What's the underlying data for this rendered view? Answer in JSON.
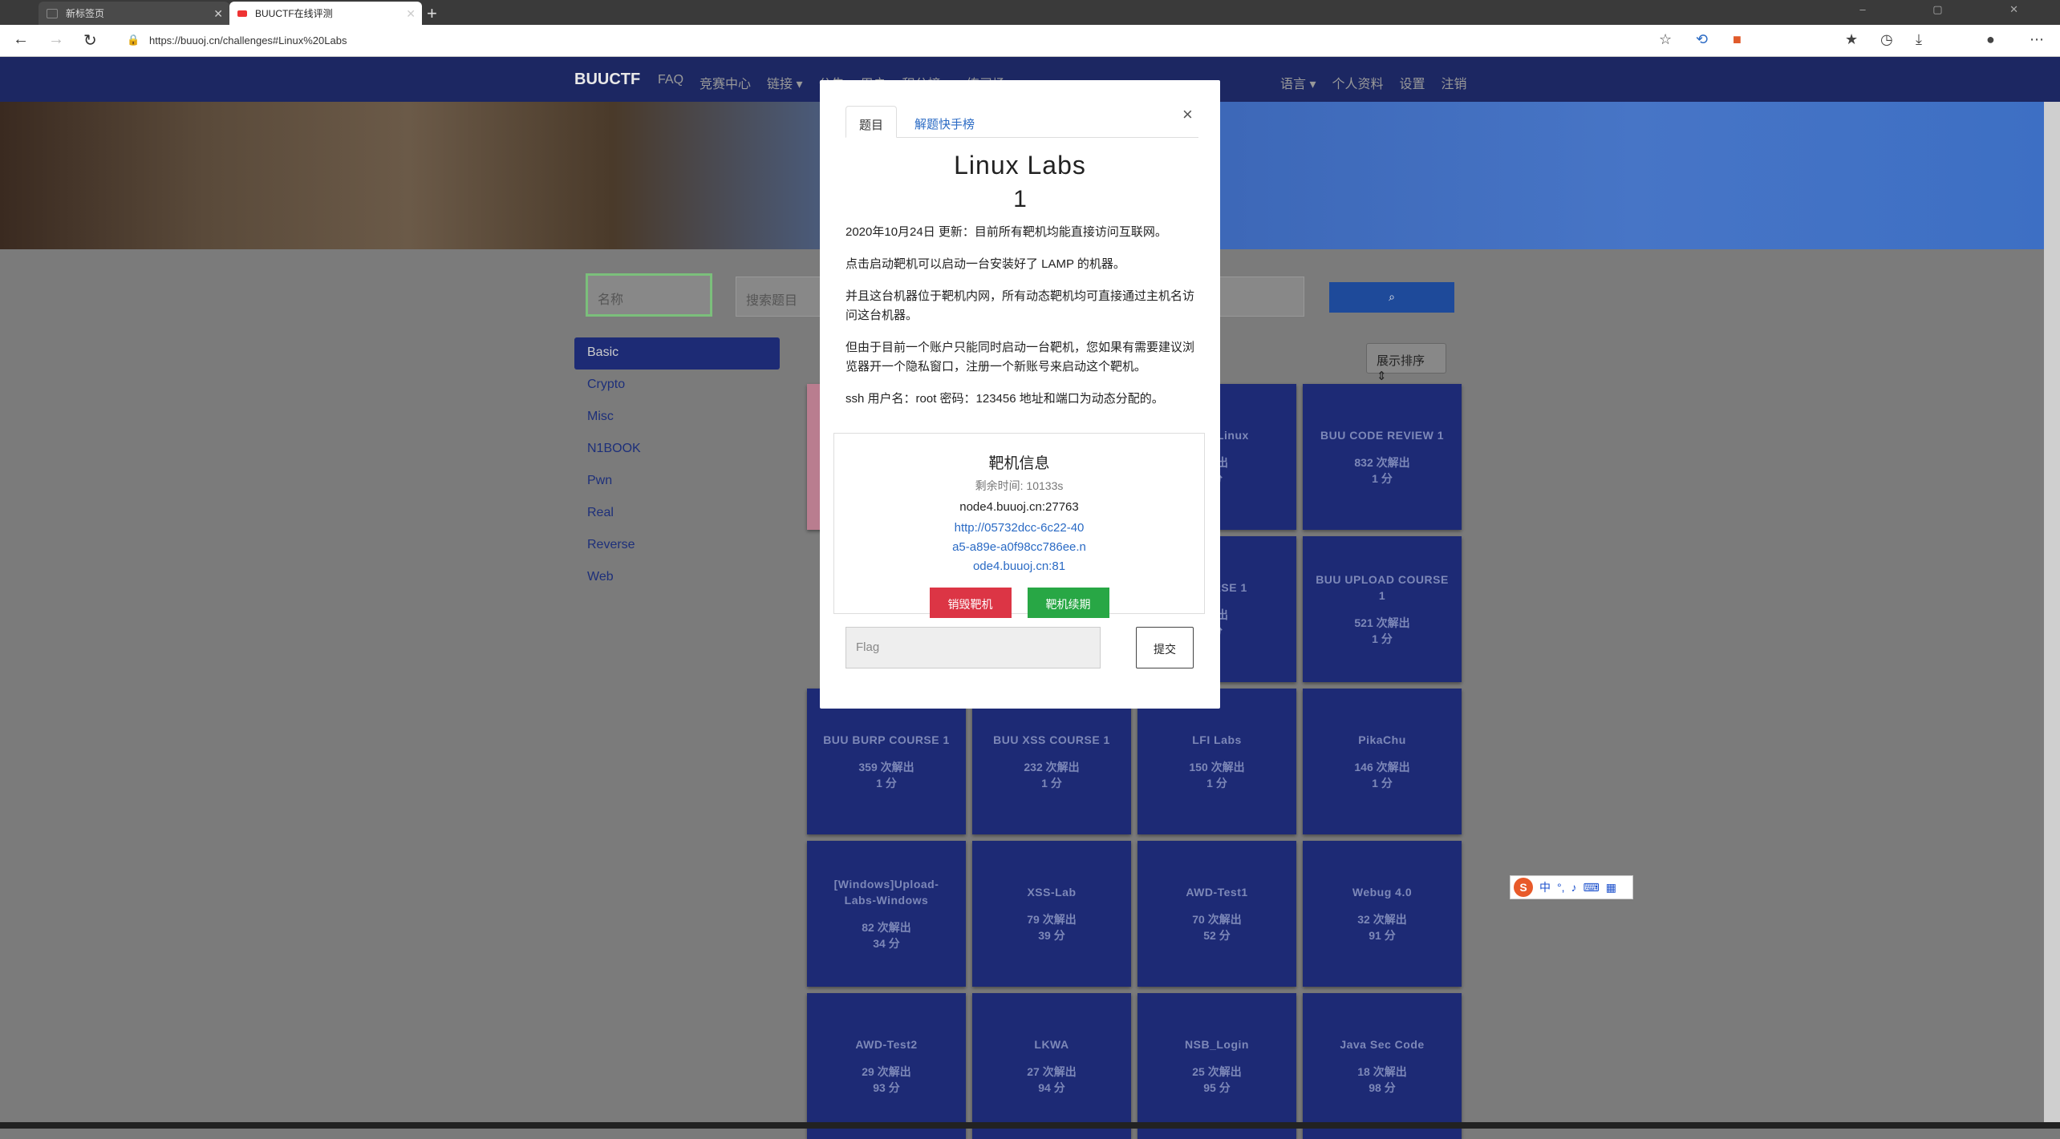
{
  "browser": {
    "tabs": [
      {
        "label": "新标签页"
      },
      {
        "label": "BUUCTF在线评测"
      }
    ],
    "url": "https://buuoj.cn/challenges#Linux%20Labs"
  },
  "site": {
    "brand": "BUUCTF",
    "nav": [
      "FAQ",
      "竞赛中心",
      "链接 ▾",
      "公告",
      "用户",
      "积分榜 ▾",
      "练习场 ▾"
    ],
    "nav_right": [
      "语言 ▾",
      "个人资料",
      "设置",
      "注销"
    ],
    "search_name_placeholder": "名称",
    "search_placeholder": "搜索题目",
    "sort_label": "展示排序 ⇕",
    "categories": [
      "Basic",
      "Crypto",
      "Misc",
      "N1BOOK",
      "Pwn",
      "Real",
      "Reverse",
      "Web"
    ],
    "cards": [
      {
        "title": "",
        "solves": "",
        "points": "",
        "style": "red"
      },
      {
        "title": "",
        "solves": "",
        "points": "",
        "style": "placeholder"
      },
      {
        "title": "Labs-Linux",
        "solves": "解出",
        "points": "分",
        "style": "normal"
      },
      {
        "title": "BUU CODE REVIEW 1",
        "solves": "832 次解出",
        "points": "1 分",
        "style": "normal"
      },
      {
        "title": "",
        "solves": "",
        "points": "",
        "style": "placeholder"
      },
      {
        "title": "",
        "solves": "",
        "points": "",
        "style": "placeholder"
      },
      {
        "title": "COURSE 1",
        "solves": "解出",
        "points": "分",
        "style": "normal"
      },
      {
        "title": "BUU UPLOAD COURSE 1",
        "solves": "521 次解出",
        "points": "1 分",
        "style": "normal"
      },
      {
        "title": "BUU BURP COURSE 1",
        "solves": "359 次解出",
        "points": "1 分",
        "style": "normal"
      },
      {
        "title": "BUU XSS COURSE 1",
        "solves": "232 次解出",
        "points": "1 分",
        "style": "normal"
      },
      {
        "title": "LFI Labs",
        "solves": "150 次解出",
        "points": "1 分",
        "style": "normal"
      },
      {
        "title": "PikaChu",
        "solves": "146 次解出",
        "points": "1 分",
        "style": "normal"
      },
      {
        "title": "[Windows]Upload-Labs-Windows",
        "solves": "82 次解出",
        "points": "34 分",
        "style": "normal"
      },
      {
        "title": "XSS-Lab",
        "solves": "79 次解出",
        "points": "39 分",
        "style": "normal"
      },
      {
        "title": "AWD-Test1",
        "solves": "70 次解出",
        "points": "52 分",
        "style": "normal"
      },
      {
        "title": "Webug 4.0",
        "solves": "32 次解出",
        "points": "91 分",
        "style": "normal"
      },
      {
        "title": "AWD-Test2",
        "solves": "29 次解出",
        "points": "93 分",
        "style": "normal"
      },
      {
        "title": "LKWA",
        "solves": "27 次解出",
        "points": "94 分",
        "style": "normal"
      },
      {
        "title": "NSB_Login",
        "solves": "25 次解出",
        "points": "95 分",
        "style": "normal"
      },
      {
        "title": "Java Sec Code",
        "solves": "18 次解出",
        "points": "98 分",
        "style": "normal"
      }
    ]
  },
  "modal": {
    "tab_challenge": "题目",
    "tab_solves": "解题快手榜",
    "close": "×",
    "title": "Linux Labs",
    "value": "1",
    "description": [
      "2020年10月24日 更新：目前所有靶机均能直接访问互联网。",
      "点击启动靶机可以启动一台安装好了 LAMP 的机器。",
      "并且这台机器位于靶机内网，所有动态靶机均可直接通过主机名访问这台机器。",
      "但由于目前一个账户只能同时启动一台靶机，您如果有需要建议浏览器开一个隐私窗口，注册一个新账号来启动这个靶机。",
      "ssh 用户名：root 密码：123456 地址和端口为动态分配的。"
    ],
    "target": {
      "title": "靶机信息",
      "remaining": "剩余时间: 10133s",
      "host": "node4.buuoj.cn:27763",
      "url": "http://05732dcc-6c22-40a5-a89e-a0f98cc786ee.node4.buuoj.cn:81",
      "destroy_label": "销毁靶机",
      "renew_label": "靶机续期"
    },
    "flag_placeholder": "Flag",
    "submit_label": "提交"
  },
  "ime": {
    "label": "中"
  }
}
